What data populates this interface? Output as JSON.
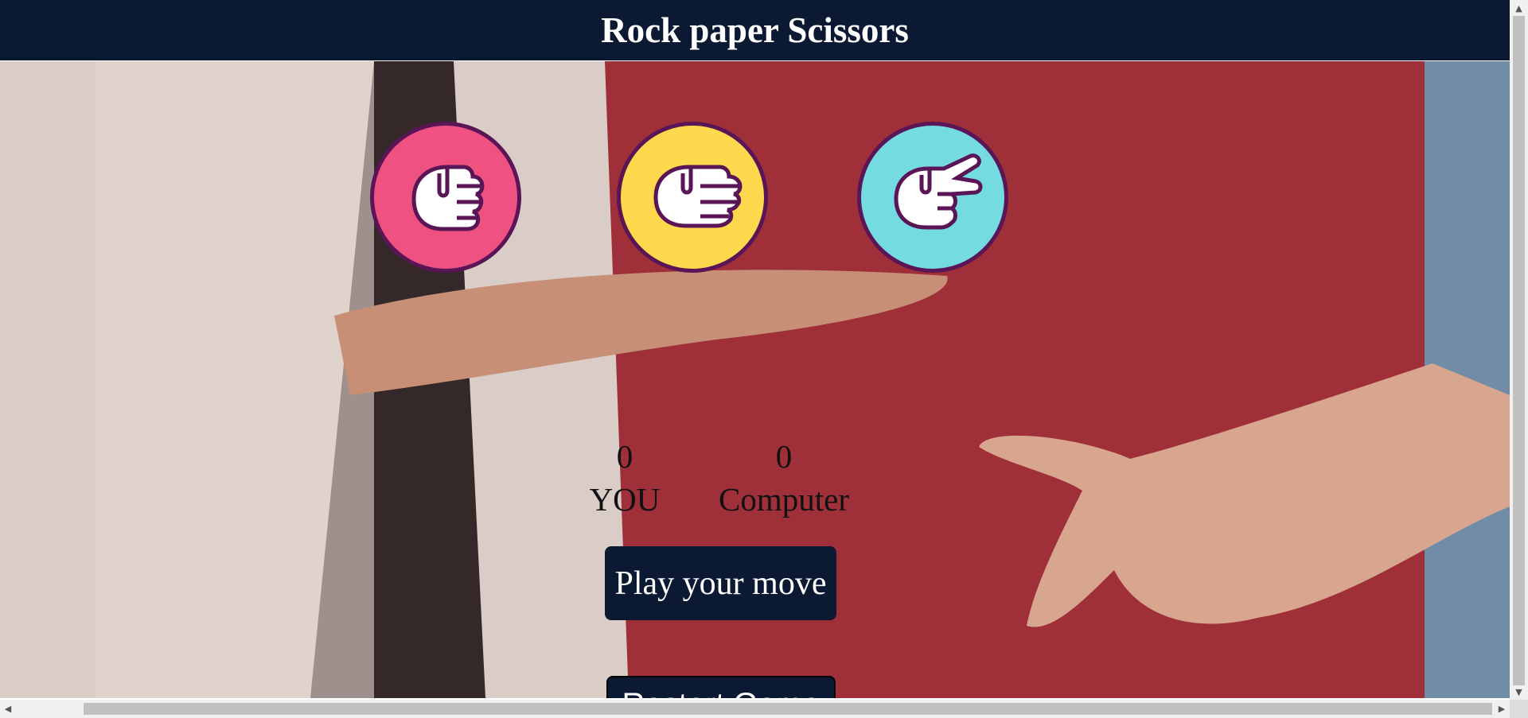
{
  "header": {
    "title": "Rock paper Scissors"
  },
  "colors": {
    "header_bg": "#0b1a32",
    "rock": "#ef5281",
    "paper": "#ffd84d",
    "scissors": "#75dbe3",
    "icon_border": "#5a1557"
  },
  "choices": [
    {
      "name": "rock",
      "icon": "fist-hand-icon"
    },
    {
      "name": "paper",
      "icon": "flat-hand-icon"
    },
    {
      "name": "scissors",
      "icon": "scissors-hand-icon"
    }
  ],
  "score": {
    "user": {
      "value": "0",
      "label": "YOU"
    },
    "computer": {
      "value": "0",
      "label": "Computer"
    }
  },
  "buttons": {
    "play": "Play your move",
    "restart": "Restart Game"
  }
}
